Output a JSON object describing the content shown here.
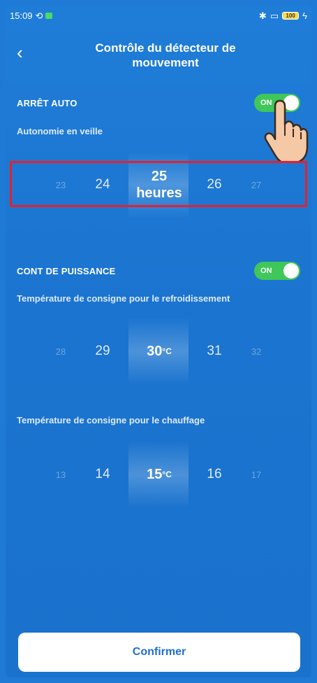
{
  "status_bar": {
    "time": "15:09",
    "battery": "100",
    "icons": [
      "sync-icon",
      "app-notification-icon",
      "bluetooth-icon",
      "vibrate-icon",
      "battery-icon",
      "charging-icon"
    ]
  },
  "header": {
    "back_icon": "chevron-left-icon",
    "title_line1": "Contrôle du détecteur de",
    "title_line2": "mouvement"
  },
  "arret_auto": {
    "label": "ARRÊT AUTO",
    "toggle_label": "ON",
    "toggle_on": true,
    "sub_label": "Autonomie en veille",
    "picker": {
      "far_left": "23",
      "near_left": "24",
      "selected": "25",
      "selected_unit": "heures",
      "near_right": "26",
      "far_right": "27"
    }
  },
  "cont_puissance": {
    "label": "CONT DE PUISSANCE",
    "toggle_label": "ON",
    "toggle_on": true,
    "cooling": {
      "label": "Température de consigne pour le refroidissement",
      "far_left": "28",
      "near_left": "29",
      "selected": "30",
      "selected_unit": "°C",
      "near_right": "31",
      "far_right": "32"
    },
    "heating": {
      "label": "Température de consigne pour le chauffage",
      "far_left": "13",
      "near_left": "14",
      "selected": "15",
      "selected_unit": "°C",
      "near_right": "16",
      "far_right": "17"
    }
  },
  "confirm_label": "Confirmer",
  "colors": {
    "background": "#1f7ad6",
    "toggle_on": "#3fc75a",
    "highlight_box": "#e8202c",
    "button_text": "#1f6fc9"
  }
}
